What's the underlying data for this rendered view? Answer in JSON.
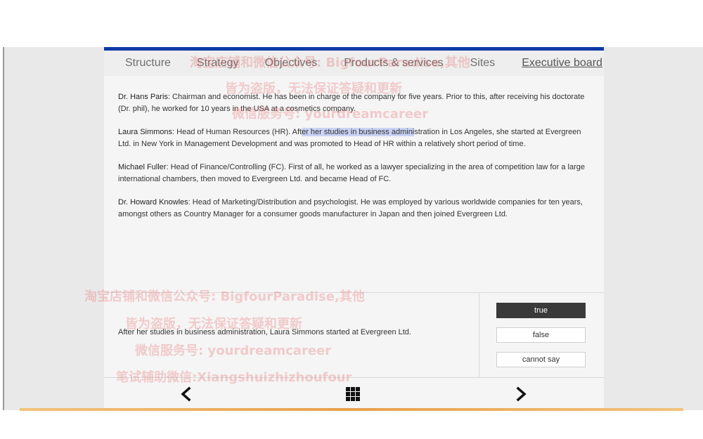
{
  "tabs": [
    {
      "label": "Structure"
    },
    {
      "label": "Strategy"
    },
    {
      "label": "Objectives"
    },
    {
      "label": "Products & services"
    },
    {
      "label": "Sites"
    },
    {
      "label": "Executive board"
    }
  ],
  "active_tab": "Executive board",
  "board": [
    {
      "name": "Dr. Hans Paris",
      "text": ": Chairman and economist. He has been in charge of the company for five years. Prior to this, after receiving his doctorate (Dr. phil), he worked for 10 years in the USA at a cosmetics company."
    },
    {
      "name": "Laura Simmons",
      "text_before": ": Head of Human Resources (HR). Aft",
      "text_highlight": "er her studies in business admini",
      "text_after": "stration in Los Angeles, she started at Evergreen Ltd. in New York in Management Development and was promoted to Head of HR within a relatively short period of time."
    },
    {
      "name": "Michael Fuller",
      "text": ": Head of Finance/Controlling (FC). First of all, he worked as a lawyer specializing in the area of competition law for a large international chambers, then moved to Evergreen Ltd. and became Head of FC."
    },
    {
      "name": "Dr. Howard Knowles",
      "text": ": Head of Marketing/Distribution and psychologist. He was employed by various worldwide companies for ten years, amongst others as Country Manager for a consumer goods manufacturer in Japan and then joined Evergreen Ltd."
    }
  ],
  "question": {
    "statement": "After her studies in business administration, Laura Simmons started at Evergreen Ltd.",
    "options": [
      "true",
      "false",
      "cannot say"
    ],
    "selected": "true"
  },
  "nav": {
    "prev_icon": "chevron-left-icon",
    "menu_icon": "grid-menu-icon",
    "next_icon": "chevron-right-icon"
  },
  "watermarks": {
    "line1": "淘宝店铺和微信公众号: BigfourParadise,其他",
    "line2": "皆为盗版，无法保证答疑和更新",
    "line3": "微信服务号: yourdreamcareer",
    "line4": "笔试辅助微信:Xiangshuizhizhoufour"
  },
  "colors": {
    "topbar": "#0b3aa6",
    "selected_answer": "#3a3a3a",
    "highlight": "#c8d3f5"
  }
}
